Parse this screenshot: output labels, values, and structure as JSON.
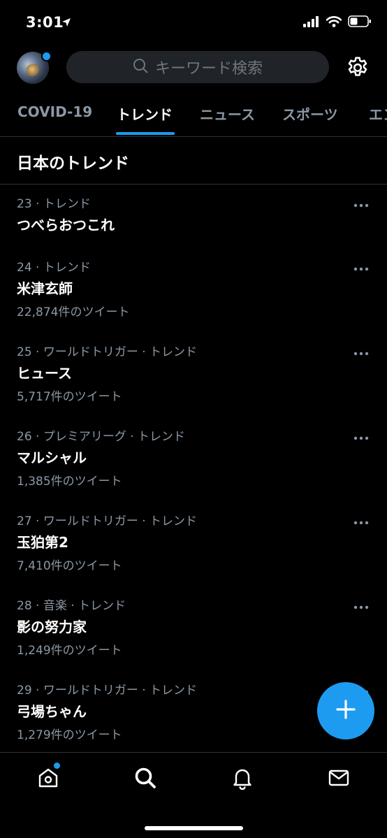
{
  "status_bar": {
    "time": "3:01"
  },
  "header": {
    "search_placeholder": "キーワード検索"
  },
  "tabs": [
    {
      "label": "COVID-19",
      "active": false
    },
    {
      "label": "トレンド",
      "active": true
    },
    {
      "label": "ニュース",
      "active": false
    },
    {
      "label": "スポーツ",
      "active": false
    },
    {
      "label": "エン",
      "active": false
    }
  ],
  "section": {
    "title": "日本のトレンド"
  },
  "trends": [
    {
      "meta": "23 · トレンド",
      "name": "つべらおつこれ",
      "count": ""
    },
    {
      "meta": "24 · トレンド",
      "name": "米津玄師",
      "count": "22,874件のツイート"
    },
    {
      "meta": "25 · ワールドトリガー · トレンド",
      "name": "ヒュース",
      "count": "5,717件のツイート"
    },
    {
      "meta": "26 · プレミアリーグ · トレンド",
      "name": "マルシャル",
      "count": "1,385件のツイート"
    },
    {
      "meta": "27 · ワールドトリガー · トレンド",
      "name": "玉狛第2",
      "count": "7,410件のツイート"
    },
    {
      "meta": "28 · 音楽 · トレンド",
      "name": "影の努力家",
      "count": "1,249件のツイート"
    },
    {
      "meta": "29 · ワールドトリガー · トレンド",
      "name": "弓場ちゃん",
      "count": "1,279件のツイート"
    }
  ],
  "colors": {
    "accent": "#1d9bf0",
    "muted_text": "#8b98a5",
    "divider": "#2f3336",
    "search_bg": "#202327"
  },
  "icons": {
    "status": [
      "location-arrow-icon",
      "signal-icon",
      "wifi-icon",
      "battery-icon"
    ],
    "header": [
      "avatar",
      "search-icon",
      "gear-icon"
    ],
    "trend_row": "more-icon",
    "fab": "plus-icon",
    "nav": [
      "home-icon",
      "search-icon",
      "bell-icon",
      "mail-icon"
    ]
  }
}
